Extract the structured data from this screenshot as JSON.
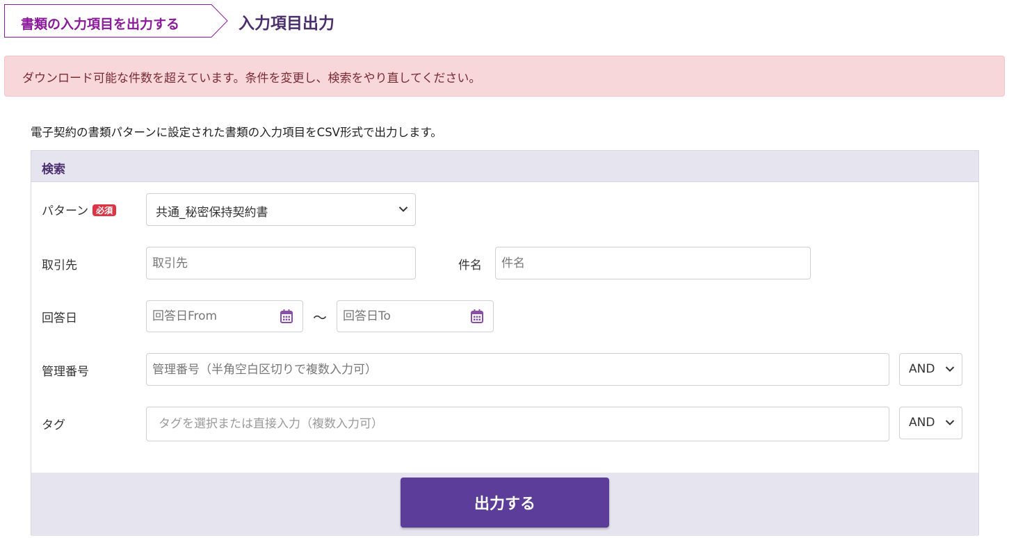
{
  "breadcrumb": {
    "parent": "書類の入力項目を出力する"
  },
  "page_title": "入力項目出力",
  "alert": {
    "message": "ダウンロード可能な件数を超えています。条件を変更し、検索をやり直してください。"
  },
  "description": "電子契約の書類パターンに設定された書類の入力項目をCSV形式で出力します。",
  "search": {
    "title": "検索",
    "pattern": {
      "label": "パターン",
      "required_badge": "必須",
      "value": "共通_秘密保持契約書"
    },
    "partner": {
      "label": "取引先",
      "placeholder": "取引先"
    },
    "subject": {
      "label": "件名",
      "placeholder": "件名"
    },
    "answer_date": {
      "label": "回答日",
      "from_placeholder": "回答日From",
      "to_placeholder": "回答日To",
      "separator": "～"
    },
    "management_no": {
      "label": "管理番号",
      "placeholder": "管理番号（半角空白区切りで複数入力可）",
      "operator": "AND"
    },
    "tag": {
      "label": "タグ",
      "placeholder": "タグを選択または直接入力（複数入力可）",
      "operator": "AND"
    }
  },
  "submit_label": "出力する",
  "colors": {
    "primary": "#5c3d99",
    "breadcrumb_text": "#8b1a9b",
    "alert_bg": "#f8d7da",
    "required_badge": "#dc3545",
    "panel_header_bg": "#e6e4ee"
  },
  "icons": {
    "calendar": "calendar-icon",
    "chevron": "chevron-down-icon"
  }
}
